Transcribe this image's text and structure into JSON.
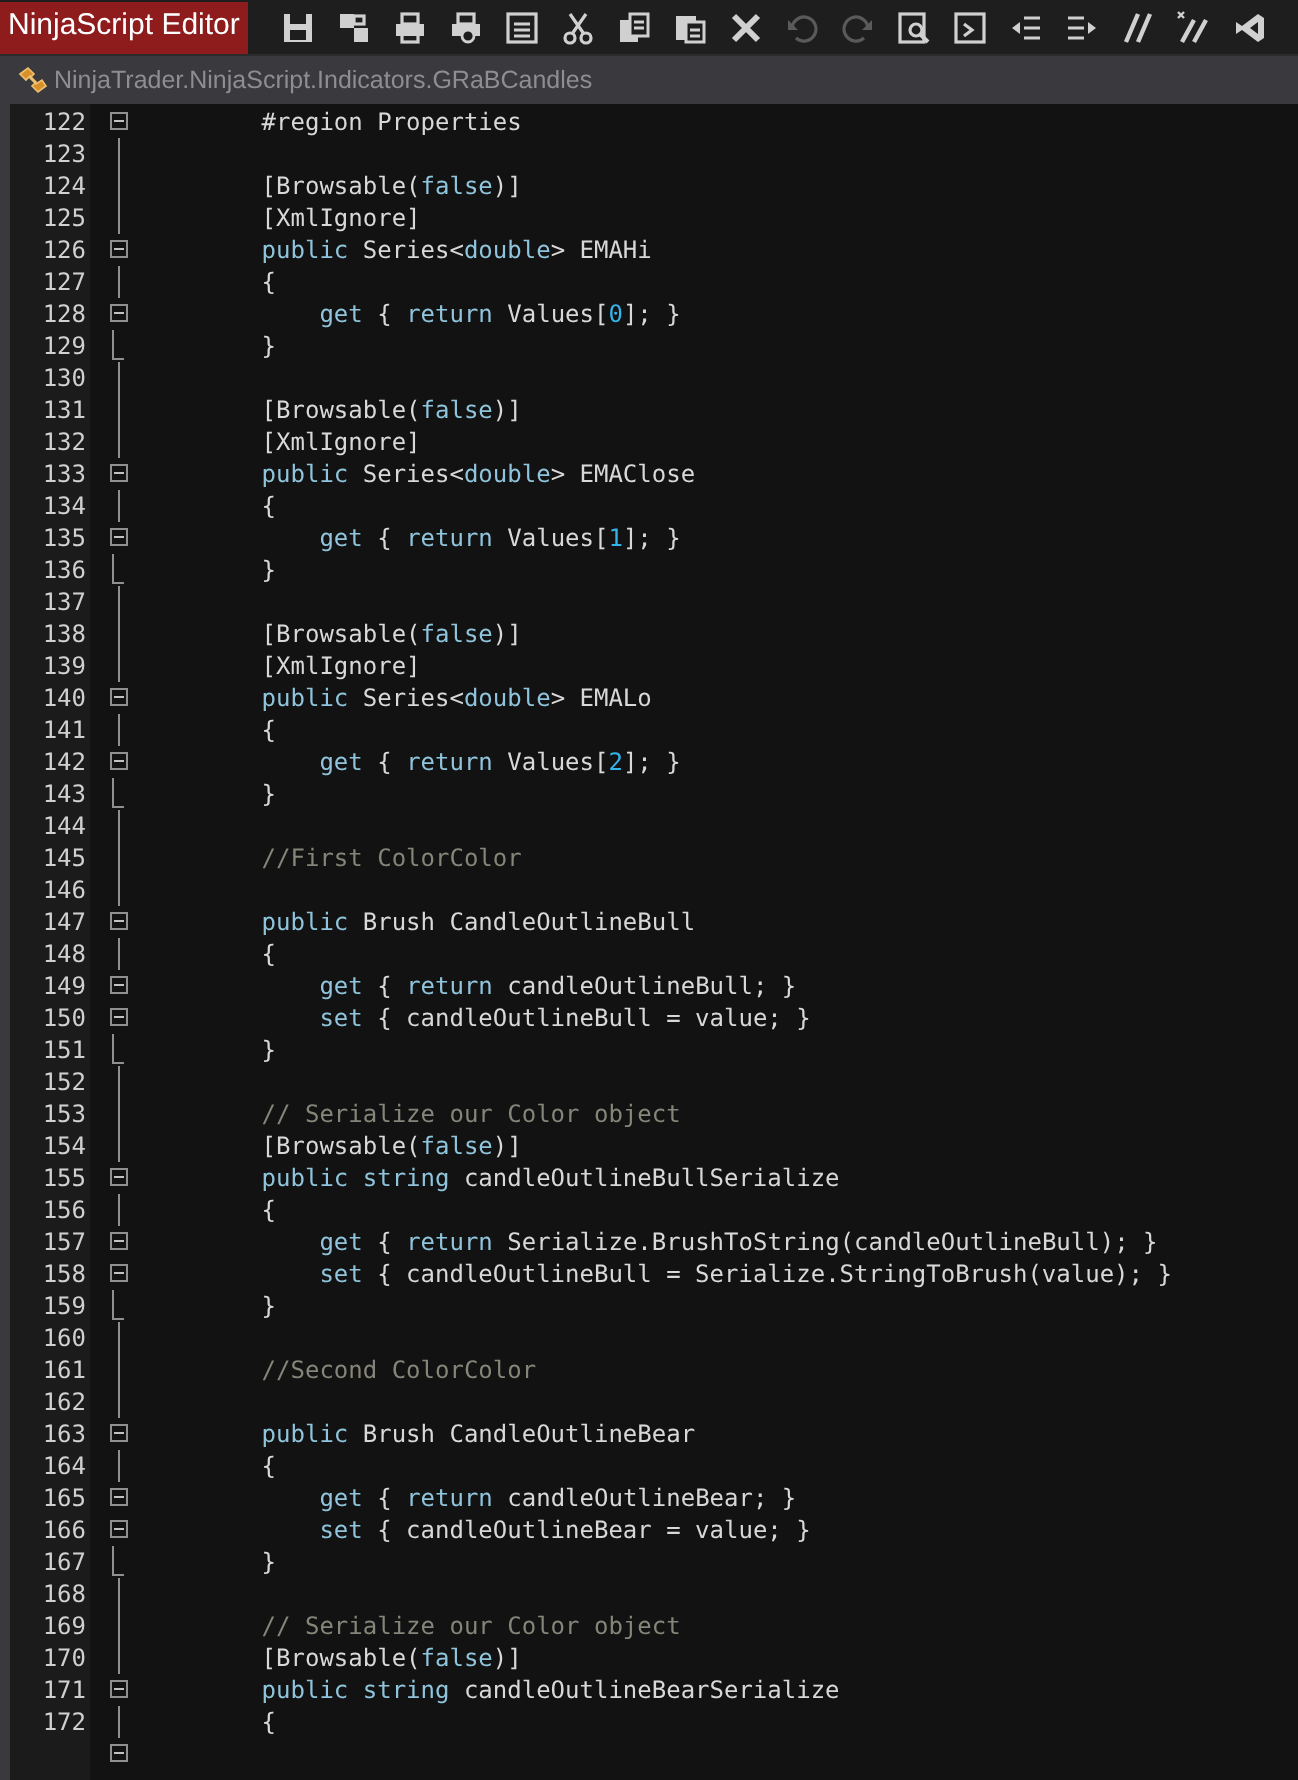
{
  "window": {
    "title": "NinjaScript Editor"
  },
  "toolbar_buttons": [
    {
      "disabled": false
    },
    {
      "disabled": false
    },
    {
      "disabled": false
    },
    {
      "disabled": false
    },
    {
      "disabled": false
    },
    {
      "disabled": false
    },
    {
      "disabled": false
    },
    {
      "disabled": false
    },
    {
      "disabled": false
    },
    {
      "disabled": true
    },
    {
      "disabled": true
    },
    {
      "disabled": false
    },
    {
      "disabled": false
    },
    {
      "disabled": false
    },
    {
      "disabled": false
    },
    {
      "disabled": false
    },
    {
      "disabled": false
    },
    {
      "disabled": false
    }
  ],
  "tab": {
    "label": "NinjaTrader.NinjaScript.Indicators.GRaBCandles"
  },
  "lines": [
    {
      "number": "122",
      "kind": "open",
      "tokens": [
        {
          "kind": "txt",
          "text": "        #region Properties"
        }
      ]
    },
    {
      "number": "123",
      "kind": "body"
    },
    {
      "number": "124",
      "kind": "body",
      "tokens": [
        {
          "kind": "txt",
          "text": "        [Browsable("
        },
        {
          "kind": "kw",
          "text": "false"
        },
        {
          "kind": "txt",
          "text": ")]"
        }
      ]
    },
    {
      "number": "125",
      "kind": "body",
      "tokens": [
        {
          "kind": "txt",
          "text": "        [XmlIgnore]"
        }
      ]
    },
    {
      "number": "126",
      "kind": "open",
      "tokens": [
        {
          "kind": "kw",
          "text": "        public"
        },
        {
          "kind": "txt",
          "text": " Series<"
        },
        {
          "kind": "kw",
          "text": "double"
        },
        {
          "kind": "txt",
          "text": "> EMAHi"
        }
      ]
    },
    {
      "number": "127",
      "kind": "body",
      "tokens": [
        {
          "kind": "txt",
          "text": "        {"
        }
      ]
    },
    {
      "number": "128",
      "kind": "open",
      "tokens": [
        {
          "kind": "kw",
          "text": "            get"
        },
        {
          "kind": "txt",
          "text": " { "
        },
        {
          "kind": "kw",
          "text": "return"
        },
        {
          "kind": "txt",
          "text": " Values["
        },
        {
          "kind": "num",
          "text": "0"
        },
        {
          "kind": "txt",
          "text": "]; }"
        }
      ]
    },
    {
      "number": "129",
      "kind": "end",
      "tokens": [
        {
          "kind": "txt",
          "text": "        }"
        }
      ]
    },
    {
      "number": "130",
      "kind": "body"
    },
    {
      "number": "131",
      "kind": "body",
      "tokens": [
        {
          "kind": "txt",
          "text": "        [Browsable("
        },
        {
          "kind": "kw",
          "text": "false"
        },
        {
          "kind": "txt",
          "text": ")]"
        }
      ]
    },
    {
      "number": "132",
      "kind": "body",
      "tokens": [
        {
          "kind": "txt",
          "text": "        [XmlIgnore]"
        }
      ]
    },
    {
      "number": "133",
      "kind": "open",
      "tokens": [
        {
          "kind": "kw",
          "text": "        public"
        },
        {
          "kind": "txt",
          "text": " Series<"
        },
        {
          "kind": "kw",
          "text": "double"
        },
        {
          "kind": "txt",
          "text": "> EMAClose"
        }
      ]
    },
    {
      "number": "134",
      "kind": "body",
      "tokens": [
        {
          "kind": "txt",
          "text": "        {"
        }
      ]
    },
    {
      "number": "135",
      "kind": "open",
      "tokens": [
        {
          "kind": "kw",
          "text": "            get"
        },
        {
          "kind": "txt",
          "text": " { "
        },
        {
          "kind": "kw",
          "text": "return"
        },
        {
          "kind": "txt",
          "text": " Values["
        },
        {
          "kind": "num",
          "text": "1"
        },
        {
          "kind": "txt",
          "text": "]; }"
        }
      ]
    },
    {
      "number": "136",
      "kind": "end",
      "tokens": [
        {
          "kind": "txt",
          "text": "        }"
        }
      ]
    },
    {
      "number": "137",
      "kind": "body"
    },
    {
      "number": "138",
      "kind": "body",
      "tokens": [
        {
          "kind": "txt",
          "text": "        [Browsable("
        },
        {
          "kind": "kw",
          "text": "false"
        },
        {
          "kind": "txt",
          "text": ")]"
        }
      ]
    },
    {
      "number": "139",
      "kind": "body",
      "tokens": [
        {
          "kind": "txt",
          "text": "        [XmlIgnore]"
        }
      ]
    },
    {
      "number": "140",
      "kind": "open",
      "tokens": [
        {
          "kind": "kw",
          "text": "        public"
        },
        {
          "kind": "txt",
          "text": " Series<"
        },
        {
          "kind": "kw",
          "text": "double"
        },
        {
          "kind": "txt",
          "text": "> EMALo"
        }
      ]
    },
    {
      "number": "141",
      "kind": "body",
      "tokens": [
        {
          "kind": "txt",
          "text": "        {"
        }
      ]
    },
    {
      "number": "142",
      "kind": "open",
      "tokens": [
        {
          "kind": "kw",
          "text": "            get"
        },
        {
          "kind": "txt",
          "text": " { "
        },
        {
          "kind": "kw",
          "text": "return"
        },
        {
          "kind": "txt",
          "text": " Values["
        },
        {
          "kind": "num",
          "text": "2"
        },
        {
          "kind": "txt",
          "text": "]; }"
        }
      ]
    },
    {
      "number": "143",
      "kind": "end",
      "tokens": [
        {
          "kind": "txt",
          "text": "        }"
        }
      ]
    },
    {
      "number": "144",
      "kind": "body"
    },
    {
      "number": "145",
      "kind": "body",
      "tokens": [
        {
          "kind": "com",
          "text": "        //First ColorColor"
        }
      ]
    },
    {
      "number": "146",
      "kind": "body"
    },
    {
      "number": "147",
      "kind": "open",
      "tokens": [
        {
          "kind": "kw",
          "text": "        public"
        },
        {
          "kind": "txt",
          "text": " Brush CandleOutlineBull"
        }
      ]
    },
    {
      "number": "148",
      "kind": "body",
      "tokens": [
        {
          "kind": "txt",
          "text": "        {"
        }
      ]
    },
    {
      "number": "149",
      "kind": "open",
      "tokens": [
        {
          "kind": "kw",
          "text": "            get"
        },
        {
          "kind": "txt",
          "text": " { "
        },
        {
          "kind": "kw",
          "text": "return"
        },
        {
          "kind": "txt",
          "text": " candleOutlineBull; }"
        }
      ]
    },
    {
      "number": "150",
      "kind": "open",
      "tokens": [
        {
          "kind": "kw",
          "text": "            set"
        },
        {
          "kind": "txt",
          "text": " { candleOutlineBull = value; }"
        }
      ]
    },
    {
      "number": "151",
      "kind": "end",
      "tokens": [
        {
          "kind": "txt",
          "text": "        }"
        }
      ]
    },
    {
      "number": "152",
      "kind": "body"
    },
    {
      "number": "153",
      "kind": "body",
      "tokens": [
        {
          "kind": "com",
          "text": "        // Serialize our Color object"
        }
      ]
    },
    {
      "number": "154",
      "kind": "body",
      "tokens": [
        {
          "kind": "txt",
          "text": "        [Browsable("
        },
        {
          "kind": "kw",
          "text": "false"
        },
        {
          "kind": "txt",
          "text": ")]"
        }
      ]
    },
    {
      "number": "155",
      "kind": "open",
      "tokens": [
        {
          "kind": "kw",
          "text": "        public string"
        },
        {
          "kind": "txt",
          "text": " candleOutlineBullSerialize"
        }
      ]
    },
    {
      "number": "156",
      "kind": "body",
      "tokens": [
        {
          "kind": "txt",
          "text": "        {"
        }
      ]
    },
    {
      "number": "157",
      "kind": "open",
      "tokens": [
        {
          "kind": "kw",
          "text": "            get"
        },
        {
          "kind": "txt",
          "text": " { "
        },
        {
          "kind": "kw",
          "text": "return"
        },
        {
          "kind": "txt",
          "text": " Serialize.BrushToString(candleOutlineBull); }"
        }
      ]
    },
    {
      "number": "158",
      "kind": "open",
      "tokens": [
        {
          "kind": "kw",
          "text": "            set"
        },
        {
          "kind": "txt",
          "text": " { candleOutlineBull = Serialize.StringToBrush(value); }"
        }
      ]
    },
    {
      "number": "159",
      "kind": "end",
      "tokens": [
        {
          "kind": "txt",
          "text": "        }"
        }
      ]
    },
    {
      "number": "160",
      "kind": "body"
    },
    {
      "number": "161",
      "kind": "body",
      "tokens": [
        {
          "kind": "com",
          "text": "        //Second ColorColor"
        }
      ]
    },
    {
      "number": "162",
      "kind": "body"
    },
    {
      "number": "163",
      "kind": "open",
      "tokens": [
        {
          "kind": "kw",
          "text": "        public"
        },
        {
          "kind": "txt",
          "text": " Brush CandleOutlineBear"
        }
      ]
    },
    {
      "number": "164",
      "kind": "body",
      "tokens": [
        {
          "kind": "txt",
          "text": "        {"
        }
      ]
    },
    {
      "number": "165",
      "kind": "open",
      "tokens": [
        {
          "kind": "kw",
          "text": "            get"
        },
        {
          "kind": "txt",
          "text": " { "
        },
        {
          "kind": "kw",
          "text": "return"
        },
        {
          "kind": "txt",
          "text": " candleOutlineBear; }"
        }
      ]
    },
    {
      "number": "166",
      "kind": "open",
      "tokens": [
        {
          "kind": "kw",
          "text": "            set"
        },
        {
          "kind": "txt",
          "text": " { candleOutlineBear = value; }"
        }
      ]
    },
    {
      "number": "167",
      "kind": "end",
      "tokens": [
        {
          "kind": "txt",
          "text": "        }"
        }
      ]
    },
    {
      "number": "168",
      "kind": "body"
    },
    {
      "number": "169",
      "kind": "body",
      "tokens": [
        {
          "kind": "com",
          "text": "        // Serialize our Color object"
        }
      ]
    },
    {
      "number": "170",
      "kind": "body",
      "tokens": [
        {
          "kind": "txt",
          "text": "        [Browsable("
        },
        {
          "kind": "kw",
          "text": "false"
        },
        {
          "kind": "txt",
          "text": ")]"
        }
      ]
    },
    {
      "number": "171",
      "kind": "open",
      "tokens": [
        {
          "kind": "kw",
          "text": "        public string"
        },
        {
          "kind": "txt",
          "text": " candleOutlineBearSerialize"
        }
      ]
    },
    {
      "number": "172",
      "kind": "body",
      "tokens": [
        {
          "kind": "txt",
          "text": "        {"
        }
      ]
    },
    {
      "kind": "open"
    }
  ]
}
